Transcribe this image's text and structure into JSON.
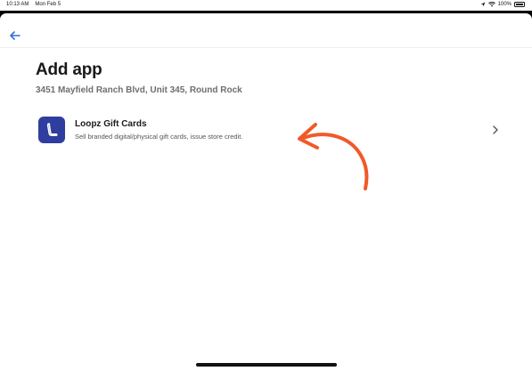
{
  "status_bar": {
    "time": "10:13 AM",
    "date": "Mon Feb 5",
    "battery_percent": "100%",
    "icons": [
      "location-icon",
      "wifi-icon",
      "battery-icon"
    ]
  },
  "nav": {
    "back_icon": "arrow-left-icon"
  },
  "page": {
    "title": "Add app",
    "subtitle": "3451 Mayfield Ranch Blvd, Unit 345, Round Rock"
  },
  "apps": [
    {
      "name": "Loopz Gift Cards",
      "description": "Sell branded digital/physical gift cards, issue store credit.",
      "icon": "loopz-logo-icon",
      "icon_color": "#2f3e9e"
    }
  ],
  "colors": {
    "accent": "#2f6fde",
    "annotation": "#f05a28",
    "app_icon_bg": "#2f3e9e"
  }
}
